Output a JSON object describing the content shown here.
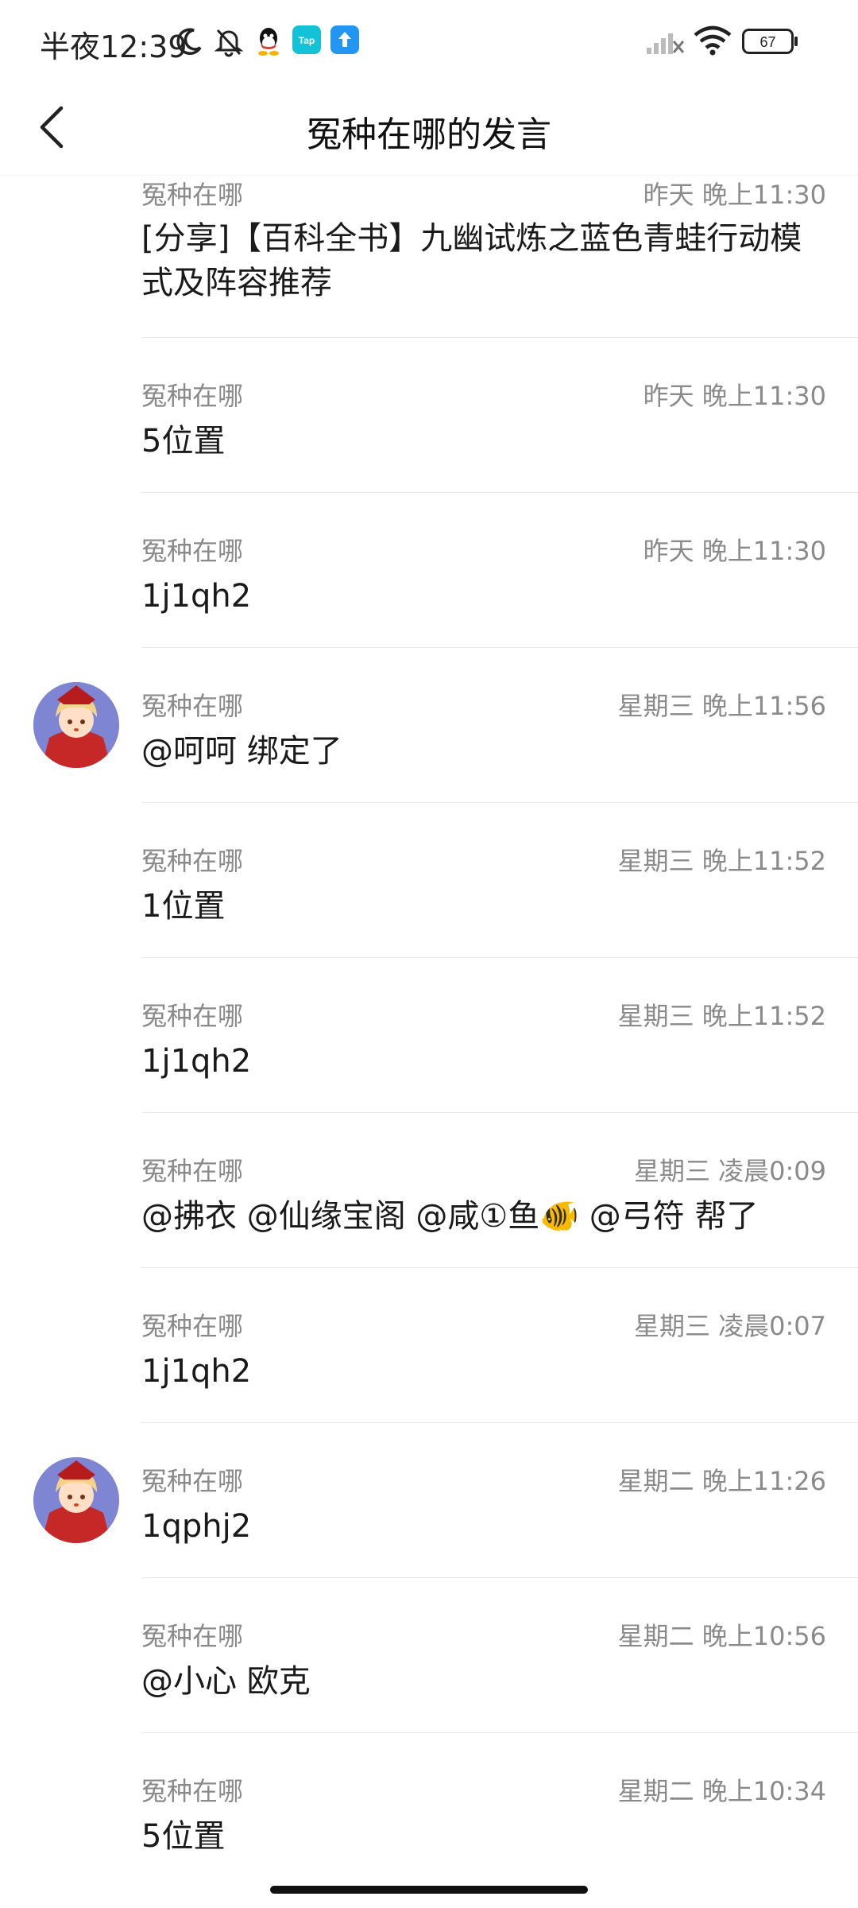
{
  "status_bar": {
    "time": "半夜12:39",
    "battery": "67",
    "icons": [
      "moon-icon",
      "bell-off-icon",
      "qq-icon",
      "taptap-icon",
      "upload-icon",
      "signal-icon",
      "wifi-icon",
      "battery-icon"
    ],
    "taptap_label": "Tap"
  },
  "header": {
    "title": "冤种在哪的发言"
  },
  "posts": [
    {
      "author": "冤种在哪",
      "time": "昨天 晚上11:30",
      "content": "[分享]【百科全书】九幽试炼之蓝色青蛙行动模式及阵容推荐",
      "avatar": false
    },
    {
      "author": "冤种在哪",
      "time": "昨天 晚上11:30",
      "content": "5位置",
      "avatar": false
    },
    {
      "author": "冤种在哪",
      "time": "昨天 晚上11:30",
      "content": "1j1qh2",
      "avatar": false
    },
    {
      "author": "冤种在哪",
      "time": "星期三 晚上11:56",
      "content": "@呵呵 绑定了",
      "avatar": true
    },
    {
      "author": "冤种在哪",
      "time": "星期三 晚上11:52",
      "content": "1位置",
      "avatar": false
    },
    {
      "author": "冤种在哪",
      "time": "星期三 晚上11:52",
      "content": "1j1qh2",
      "avatar": false
    },
    {
      "author": "冤种在哪",
      "time": "星期三 凌晨0:09",
      "content": "@拂衣 @仙缘宝阁 @咸①鱼🐠 @弓符 帮了",
      "avatar": false
    },
    {
      "author": "冤种在哪",
      "time": "星期三 凌晨0:07",
      "content": "1j1qh2",
      "avatar": false
    },
    {
      "author": "冤种在哪",
      "time": "星期二 晚上11:26",
      "content": "1qphj2",
      "avatar": true
    },
    {
      "author": "冤种在哪",
      "time": "星期二 晚上10:56",
      "content": "@小心 欧克",
      "avatar": false
    },
    {
      "author": "冤种在哪",
      "time": "星期二 晚上10:34",
      "content": "5位置",
      "avatar": false
    }
  ]
}
